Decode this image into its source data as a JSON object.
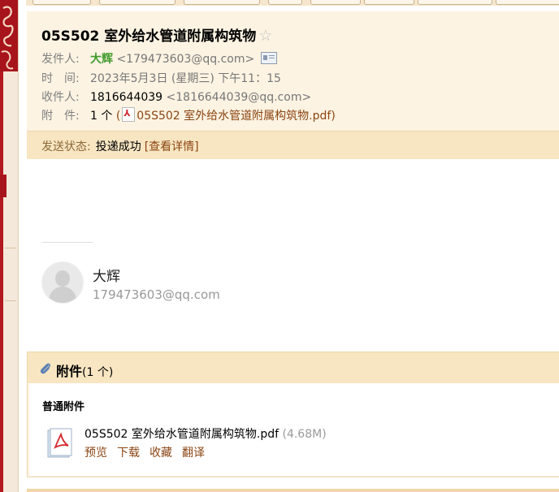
{
  "header": {
    "subject": "05S502 室外给水管道附属构筑物",
    "star_icon": "☆",
    "from_label": "发件人:",
    "from_name": "大辉",
    "from_email": "<179473603@qq.com>",
    "time_label": "时　间:",
    "time_value": "2023年5月3日 (星期三) 下午11：15",
    "to_label": "收件人:",
    "to_id": "1816644039",
    "to_email": "<1816644039@qq.com>",
    "attach_label": "附　件:",
    "attach_count": "1 个",
    "attach_open": "(",
    "attach_name": "05S502 室外给水管道附属构筑物.pdf",
    "attach_close": ")"
  },
  "status": {
    "label": "发送状态:",
    "value": "投递成功",
    "detail": "[查看详情]"
  },
  "signature": {
    "name": "大辉",
    "email": "179473603@qq.com"
  },
  "attachments": {
    "title": "附件",
    "count": "(1 个)",
    "section": "普通附件",
    "file_name": "05S502 室外给水管道附属构筑物.pdf",
    "file_size": "(4.68M)",
    "actions": {
      "preview": "预览",
      "download": "下载",
      "favorite": "收藏",
      "translate": "翻译"
    }
  },
  "colors": {
    "header_bg": "#fcf3e2",
    "status_bg": "#f8e6c2",
    "link": "#8b4513",
    "sender": "#3f9a2a",
    "brand_red": "#a8141b"
  }
}
